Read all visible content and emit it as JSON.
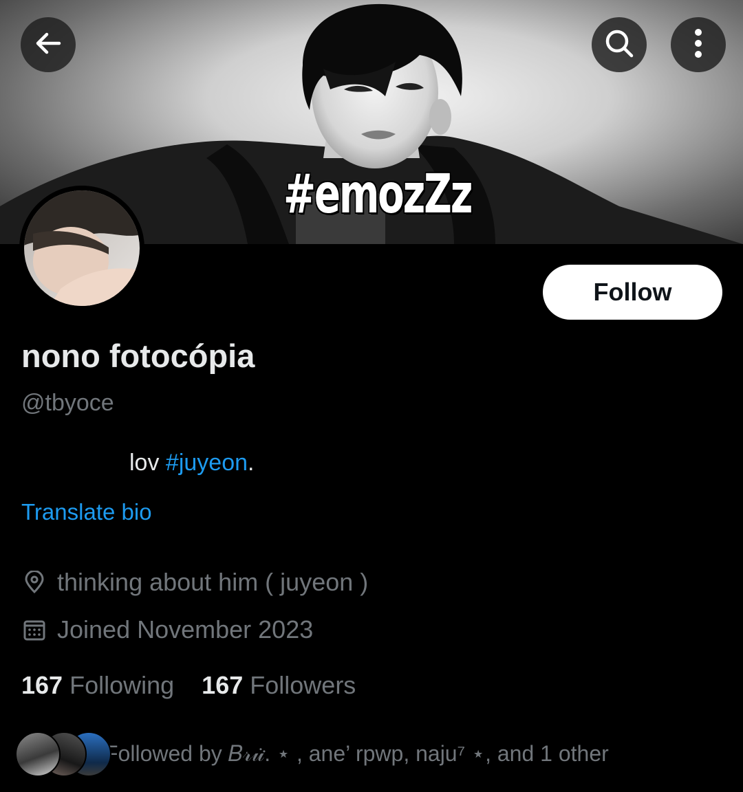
{
  "header": {
    "banner_text": "#emozZz"
  },
  "icons": {
    "back": "arrow-left-icon",
    "search": "search-icon",
    "more": "more-vertical-icon",
    "location": "location-pin-icon",
    "calendar": "calendar-icon"
  },
  "profile": {
    "display_name": "nono fotocópia",
    "handle": "@tbyoce",
    "bio_prefix": "lov ",
    "bio_hashtag": "#juyeon",
    "bio_suffix": ".",
    "translate_label": "Translate bio",
    "location": "thinking about him ( juyeon )",
    "joined": "Joined November 2023",
    "follow_label": "Follow"
  },
  "stats": {
    "following_count": "167",
    "following_label": "Following",
    "followers_count": "167",
    "followers_label": "Followers"
  },
  "followed_by": {
    "text": "Followed by 𝐵𝓇𝓊̇͘. ⋆ , ane’ rpwp, naju⁷ ⋆, and 1 other"
  },
  "colors": {
    "background": "#000000",
    "primary_text": "#e7e9ea",
    "secondary_text": "#71767b",
    "link": "#1d9bf0",
    "follow_button_bg": "#ffffff",
    "follow_button_text": "#0f1419"
  }
}
